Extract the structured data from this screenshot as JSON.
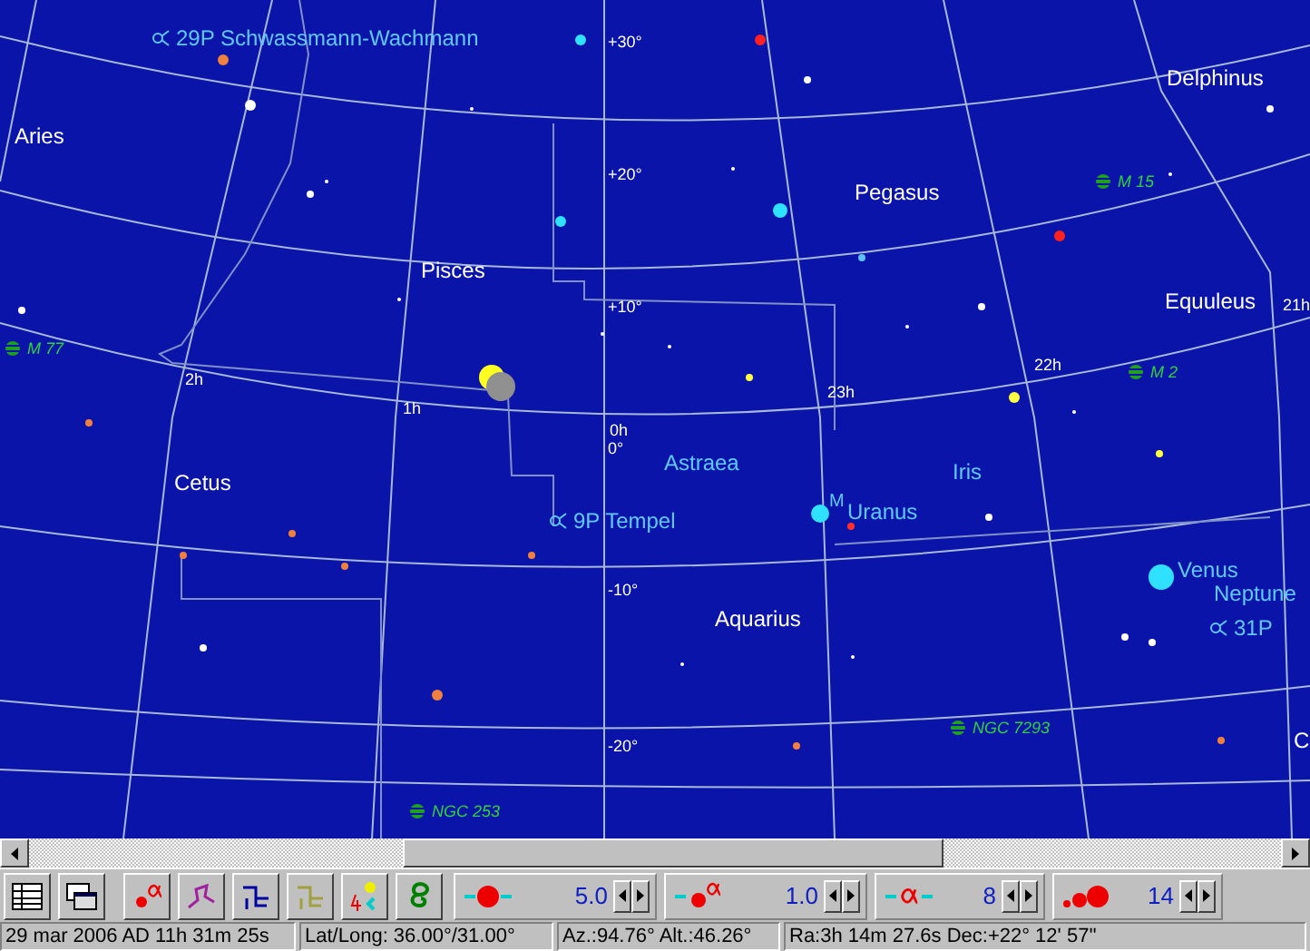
{
  "sky_map": {
    "constellations": [
      "Aries",
      "Pisces",
      "Pegasus",
      "Delphinus",
      "Equuleus",
      "Cetus",
      "Aquarius"
    ],
    "grid_labels": [
      "+30°",
      "+20°",
      "+10°",
      "0°",
      "-10°",
      "-20°",
      "2h",
      "1h",
      "0h",
      "23h",
      "22h",
      "21h"
    ],
    "objects": [
      {
        "label": "29P Schwassmann-Wachmann",
        "kind": "comet"
      },
      {
        "label": "Astraea",
        "kind": "asteroid"
      },
      {
        "label": "Iris",
        "kind": "asteroid"
      },
      {
        "label": "M",
        "kind": "planet"
      },
      {
        "label": "Uranus",
        "kind": "planet"
      },
      {
        "label": "9P Tempel",
        "kind": "comet"
      },
      {
        "label": "Venus",
        "kind": "planet"
      },
      {
        "label": "Neptune",
        "kind": "planet"
      },
      {
        "label": "31P",
        "kind": "comet"
      },
      {
        "label": "C",
        "kind": "star"
      }
    ],
    "deep_sky": [
      "M 77",
      "M 15",
      "M 2",
      "NGC 253",
      "NGC 7293"
    ]
  },
  "toolbar": {
    "spinners": [
      {
        "value": "5.0"
      },
      {
        "value": "1.0"
      },
      {
        "value": "8"
      },
      {
        "value": "14"
      }
    ]
  },
  "status_bar": [
    "29 mar 2006 AD 11h 31m 25s",
    "Lat/Long: 36.00°/31.00°",
    "Az.:94.76° Alt.:46.26°",
    "Ra:3h 14m 27.6s Dec:+22° 12' 57''"
  ]
}
